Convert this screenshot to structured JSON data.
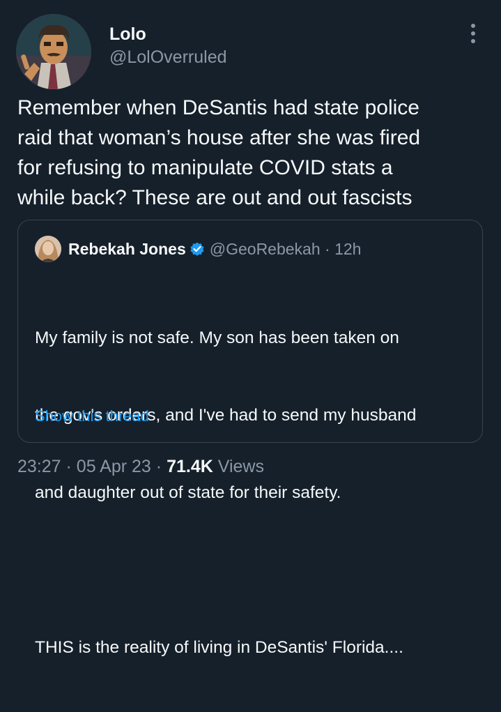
{
  "author": {
    "display_name": "Lolo",
    "handle": "@LolOverruled"
  },
  "tweet": {
    "lines": [
      "Remember when DeSantis had state police",
      "raid that woman’s house after she was fired",
      "for refusing to manipulate COVID stats a",
      "while back? These are out and out fascists"
    ]
  },
  "quote": {
    "display_name": "Rebekah Jones",
    "handle": "@GeoRebekah",
    "separator": "·",
    "time": "12h",
    "lines": [
      "My family is not safe. My son has been taken on",
      "the gov's orders, and I've had to send my husband",
      "and daughter out of state for their safety.",
      "",
      "THIS is the reality of living in DeSantis' Florida...."
    ],
    "show_thread": "Show this thread"
  },
  "footer": {
    "time": "23:27",
    "sep1": "·",
    "date": "05 Apr 23",
    "sep2": "·",
    "views_count": "71.4K",
    "views_label": "Views"
  },
  "colors": {
    "background": "#15202b",
    "text": "#f7f9f9",
    "secondary": "#8b98a5",
    "accent": "#1d9bf0",
    "border": "#38444d"
  },
  "icons": {
    "more": "more-vertical-icon",
    "verified": "verified-badge-icon"
  }
}
